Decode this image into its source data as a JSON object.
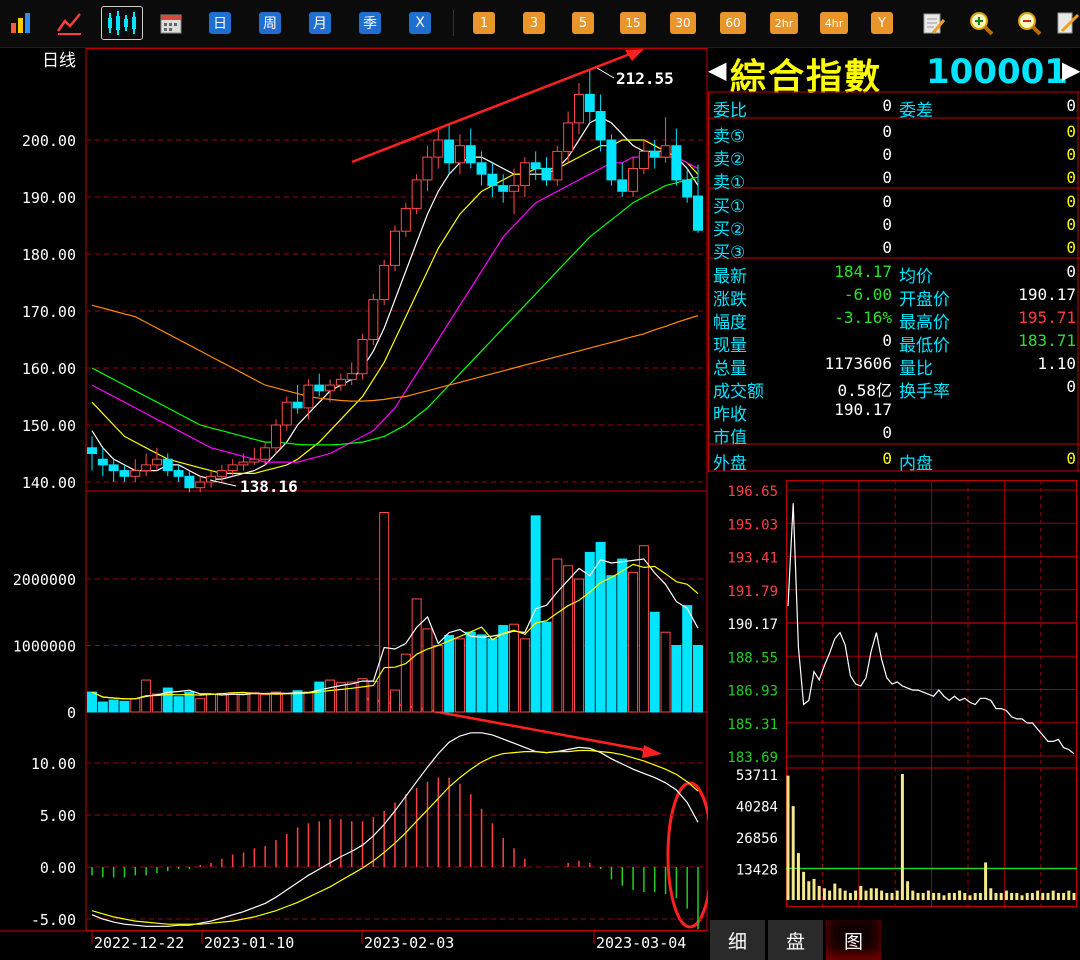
{
  "toolbar": {
    "period_buttons": [
      "日",
      "周",
      "月",
      "季",
      "X"
    ],
    "minute_buttons": [
      "1",
      "3",
      "5",
      "15",
      "30",
      "60",
      "2hr",
      "4hr",
      "Y"
    ]
  },
  "kline": {
    "period_label": "日线",
    "price_ticks": [
      "200.00",
      "190.00",
      "180.00",
      "170.00",
      "160.00",
      "150.00",
      "140.00"
    ],
    "high_label": "212.55",
    "low_label": "138.16",
    "volume_ticks": [
      "2000000",
      "1000000",
      "0"
    ],
    "macd_ticks": [
      "10.00",
      "5.00",
      "0.00",
      "-5.00"
    ],
    "dates": [
      "2022-12-22",
      "2023-01-10",
      "2023-02-03",
      "2023-03-04"
    ]
  },
  "chart_data": {
    "type": "candlestick",
    "price_axis": [
      140,
      200
    ],
    "candles": [
      {
        "o": 146,
        "c": 145,
        "h": 148,
        "l": 142
      },
      {
        "o": 144,
        "c": 143,
        "h": 146,
        "l": 141
      },
      {
        "o": 143,
        "c": 142,
        "h": 144,
        "l": 140
      },
      {
        "o": 142,
        "c": 141,
        "h": 143,
        "l": 140
      },
      {
        "o": 141,
        "c": 142,
        "h": 144,
        "l": 140
      },
      {
        "o": 142,
        "c": 143,
        "h": 145,
        "l": 141
      },
      {
        "o": 143,
        "c": 144,
        "h": 146,
        "l": 142
      },
      {
        "o": 144,
        "c": 142,
        "h": 145,
        "l": 141
      },
      {
        "o": 142,
        "c": 141,
        "h": 143,
        "l": 140
      },
      {
        "o": 141,
        "c": 139,
        "h": 142,
        "l": 138.2
      },
      {
        "o": 139,
        "c": 140,
        "h": 141,
        "l": 138.2
      },
      {
        "o": 140,
        "c": 141,
        "h": 142,
        "l": 139
      },
      {
        "o": 141,
        "c": 142,
        "h": 143,
        "l": 140
      },
      {
        "o": 142,
        "c": 143,
        "h": 144,
        "l": 141
      },
      {
        "o": 143,
        "c": 143.5,
        "h": 145,
        "l": 142
      },
      {
        "o": 143.5,
        "c": 144,
        "h": 146,
        "l": 143
      },
      {
        "o": 144,
        "c": 146,
        "h": 147,
        "l": 143
      },
      {
        "o": 146,
        "c": 150,
        "h": 151,
        "l": 145
      },
      {
        "o": 150,
        "c": 154,
        "h": 155,
        "l": 149
      },
      {
        "o": 154,
        "c": 153,
        "h": 157,
        "l": 152
      },
      {
        "o": 153,
        "c": 157,
        "h": 158,
        "l": 151
      },
      {
        "o": 157,
        "c": 156,
        "h": 159,
        "l": 155
      },
      {
        "o": 156,
        "c": 157,
        "h": 158,
        "l": 154
      },
      {
        "o": 157,
        "c": 158,
        "h": 159,
        "l": 156
      },
      {
        "o": 158,
        "c": 159,
        "h": 161,
        "l": 157
      },
      {
        "o": 159,
        "c": 165,
        "h": 166,
        "l": 158
      },
      {
        "o": 165,
        "c": 172,
        "h": 173,
        "l": 164
      },
      {
        "o": 172,
        "c": 178,
        "h": 179,
        "l": 171
      },
      {
        "o": 178,
        "c": 184,
        "h": 185,
        "l": 177
      },
      {
        "o": 184,
        "c": 188,
        "h": 189,
        "l": 183
      },
      {
        "o": 188,
        "c": 193,
        "h": 194,
        "l": 187
      },
      {
        "o": 193,
        "c": 197,
        "h": 199,
        "l": 191
      },
      {
        "o": 197,
        "c": 200,
        "h": 202,
        "l": 195
      },
      {
        "o": 200,
        "c": 196,
        "h": 203,
        "l": 194
      },
      {
        "o": 196,
        "c": 199,
        "h": 201,
        "l": 194
      },
      {
        "o": 199,
        "c": 196,
        "h": 202,
        "l": 195
      },
      {
        "o": 196,
        "c": 194,
        "h": 198,
        "l": 192
      },
      {
        "o": 194,
        "c": 192,
        "h": 196,
        "l": 190
      },
      {
        "o": 192,
        "c": 191,
        "h": 194,
        "l": 189
      },
      {
        "o": 191,
        "c": 192,
        "h": 195,
        "l": 187
      },
      {
        "o": 192,
        "c": 196,
        "h": 197,
        "l": 190
      },
      {
        "o": 196,
        "c": 195,
        "h": 198,
        "l": 193
      },
      {
        "o": 195,
        "c": 193,
        "h": 197,
        "l": 192
      },
      {
        "o": 193,
        "c": 198,
        "h": 199,
        "l": 192
      },
      {
        "o": 198,
        "c": 203,
        "h": 205,
        "l": 196
      },
      {
        "o": 203,
        "c": 208,
        "h": 210,
        "l": 201
      },
      {
        "o": 208,
        "c": 205,
        "h": 212.55,
        "l": 203
      },
      {
        "o": 205,
        "c": 200,
        "h": 208,
        "l": 198
      },
      {
        "o": 200,
        "c": 193,
        "h": 201,
        "l": 192
      },
      {
        "o": 193,
        "c": 191,
        "h": 196,
        "l": 190
      },
      {
        "o": 191,
        "c": 195,
        "h": 197,
        "l": 190
      },
      {
        "o": 195,
        "c": 198,
        "h": 200,
        "l": 194
      },
      {
        "o": 198,
        "c": 197,
        "h": 200,
        "l": 195
      },
      {
        "o": 197,
        "c": 199,
        "h": 204,
        "l": 196
      },
      {
        "o": 199,
        "c": 193,
        "h": 202,
        "l": 192
      },
      {
        "o": 193,
        "c": 190,
        "h": 195,
        "l": 189
      },
      {
        "o": 190.17,
        "c": 184.17,
        "h": 195.71,
        "l": 183.71
      }
    ],
    "ma_lines": [
      {
        "name": "MA5",
        "color": "#ffffff",
        "values": [
          149,
          146,
          144,
          143,
          142,
          142,
          142,
          143,
          143,
          142,
          141,
          140.5,
          140.5,
          141,
          141.5,
          142,
          143,
          145,
          147,
          150,
          152,
          154,
          156,
          157,
          158,
          160,
          163,
          167,
          172,
          177,
          182,
          187,
          191,
          194,
          196,
          197,
          197,
          196,
          195,
          194,
          194,
          194,
          194,
          195,
          197,
          200,
          203,
          204,
          203,
          201,
          199,
          198,
          198,
          198,
          197,
          195,
          192
        ]
      },
      {
        "name": "MA10",
        "color": "#ffff00",
        "values": [
          154,
          152,
          150,
          148,
          147,
          146,
          145,
          144,
          143.5,
          143,
          142.5,
          142,
          141.5,
          141.5,
          141.5,
          141.5,
          142,
          142.5,
          143,
          144,
          145.5,
          147,
          149,
          151,
          153,
          155,
          158,
          161,
          165,
          169,
          173,
          177,
          181,
          184,
          187,
          189,
          191,
          192,
          193,
          194,
          194,
          195,
          195,
          195,
          196,
          197,
          198,
          199,
          199,
          200,
          200,
          200,
          199,
          198,
          197,
          196,
          194
        ]
      },
      {
        "name": "MA20",
        "color": "#ff00ff",
        "values": [
          157,
          156,
          155,
          154,
          153,
          152,
          151,
          150,
          149,
          148,
          147,
          146,
          145.5,
          145,
          144.5,
          144,
          143.5,
          143.5,
          143.5,
          143.5,
          144,
          144.5,
          145,
          146,
          147,
          148,
          149,
          151,
          153,
          156,
          159,
          162,
          165,
          168,
          171,
          174,
          177,
          180,
          183,
          185,
          187,
          189,
          190,
          191,
          192,
          193,
          194,
          195,
          196,
          196,
          197,
          197,
          197,
          197,
          197,
          196,
          195
        ]
      },
      {
        "name": "MA30",
        "color": "#00ff00",
        "values": [
          160,
          159,
          158,
          157,
          156,
          155,
          154,
          153,
          152,
          151,
          150,
          149.5,
          149,
          148.5,
          148,
          147.5,
          147,
          147,
          146.8,
          146.6,
          146.5,
          146.5,
          146.5,
          146.6,
          146.8,
          147,
          147.5,
          148,
          149,
          150,
          151.5,
          153,
          155,
          157,
          159,
          161,
          163,
          165,
          167,
          169,
          171,
          173,
          175,
          177,
          179,
          181,
          183,
          184.5,
          186,
          187.5,
          189,
          190,
          191,
          192,
          192.5,
          193,
          193.5
        ]
      },
      {
        "name": "MA60",
        "color": "#ff8c00",
        "values": [
          171,
          170.5,
          170,
          169.5,
          169,
          168,
          167,
          166,
          165,
          164,
          163,
          162,
          161,
          160,
          159,
          158,
          157,
          156.5,
          156,
          155.5,
          155,
          154.7,
          154.5,
          154.3,
          154.2,
          154.2,
          154.3,
          154.5,
          154.8,
          155,
          155.5,
          156,
          156.5,
          157,
          157.5,
          158,
          158.5,
          159,
          159.5,
          160,
          160.5,
          161,
          161.5,
          162,
          162.5,
          163,
          163.5,
          164,
          164.5,
          165,
          165.5,
          166,
          166.7,
          167.3,
          168,
          168.6,
          169.2
        ]
      }
    ],
    "volume": [
      300000,
      150000,
      180000,
      160000,
      200000,
      480000,
      270000,
      360000,
      230000,
      300000,
      200000,
      270000,
      280000,
      290000,
      270000,
      290000,
      260000,
      300000,
      280000,
      320000,
      300000,
      450000,
      480000,
      440000,
      450000,
      500000,
      460000,
      3000000,
      330000,
      870000,
      1700000,
      1250000,
      1000000,
      1150000,
      1100000,
      1200000,
      1160000,
      1100000,
      1300000,
      1320000,
      1100000,
      2950000,
      1350000,
      2300000,
      2200000,
      2000000,
      2400000,
      2550000,
      2050000,
      2300000,
      2100000,
      2500000,
      1500000,
      1200000,
      1000000,
      1600000,
      1000000
    ],
    "macd_dif": [
      -4.6,
      -5.0,
      -5.3,
      -5.5,
      -5.6,
      -5.7,
      -5.7,
      -5.7,
      -5.6,
      -5.6,
      -5.4,
      -5.2,
      -4.9,
      -4.6,
      -4.3,
      -3.9,
      -3.5,
      -2.9,
      -2.2,
      -1.5,
      -0.8,
      -0.2,
      0.4,
      1.0,
      1.5,
      2.1,
      3.0,
      4.1,
      5.4,
      6.8,
      8.2,
      9.6,
      10.9,
      12.0,
      12.6,
      12.9,
      12.9,
      12.7,
      12.3,
      11.9,
      11.5,
      11.1,
      11.0,
      11.1,
      11.3,
      11.5,
      11.4,
      11.0,
      10.4,
      9.9,
      9.4,
      9.0,
      8.6,
      8.1,
      7.4,
      6.2,
      4.3
    ],
    "macd_dea": [
      -4.2,
      -4.5,
      -4.8,
      -5.0,
      -5.2,
      -5.3,
      -5.4,
      -5.5,
      -5.5,
      -5.5,
      -5.5,
      -5.4,
      -5.3,
      -5.2,
      -5.0,
      -4.8,
      -4.5,
      -4.2,
      -3.8,
      -3.4,
      -2.9,
      -2.4,
      -1.9,
      -1.3,
      -0.7,
      -0.1,
      0.6,
      1.4,
      2.3,
      3.3,
      4.4,
      5.5,
      6.6,
      7.7,
      8.6,
      9.4,
      10.1,
      10.6,
      10.9,
      11.0,
      11.1,
      11.1,
      11.0,
      11.1,
      11.1,
      11.2,
      11.2,
      11.1,
      11.0,
      10.8,
      10.5,
      10.2,
      9.8,
      9.4,
      8.9,
      8.2,
      7.3
    ]
  },
  "quote": {
    "name": "綜合指數",
    "code": "100001",
    "rows": [
      {
        "l1": "委比",
        "v1": "0",
        "l2": "委差",
        "v2": "0",
        "c2": "v-white"
      },
      {
        "l1": "卖⑤",
        "v1": "0",
        "v2": "0",
        "c2": "v-yellow"
      },
      {
        "l1": "卖②",
        "v1": "0",
        "v2": "0",
        "c2": "v-yellow"
      },
      {
        "l1": "卖①",
        "v1": "0",
        "v2": "0",
        "c2": "v-yellow"
      },
      {
        "l1": "买①",
        "v1": "0",
        "v2": "0",
        "c2": "v-yellow"
      },
      {
        "l1": "买②",
        "v1": "0",
        "v2": "0",
        "c2": "v-yellow"
      },
      {
        "l1": "买③",
        "v1": "0",
        "v2": "0",
        "c2": "v-yellow"
      },
      {
        "l1": "最新",
        "v1": "184.17",
        "c1": "v-green",
        "l2": "均价",
        "v2": "0",
        "c2": "v-white"
      },
      {
        "l1": "涨跌",
        "v1": "-6.00",
        "c1": "v-green",
        "l2": "开盘价",
        "v2": "190.17",
        "c2": "v-white"
      },
      {
        "l1": "幅度",
        "v1": "-3.16%",
        "c1": "v-green",
        "l2": "最高价",
        "v2": "195.71",
        "c2": "v-red"
      },
      {
        "l1": "现量",
        "v1": "0",
        "l2": "最低价",
        "v2": "183.71",
        "c2": "v-green"
      },
      {
        "l1": "总量",
        "v1": "1173606",
        "l2": "量比",
        "v2": "1.10",
        "c2": "v-white"
      },
      {
        "l1": "成交额",
        "v1": "0.58亿",
        "l2": "换手率",
        "v2": "0",
        "c2": "v-white"
      },
      {
        "l1": "昨收",
        "v1": "190.17"
      },
      {
        "l1": "市值",
        "v1": "0"
      },
      {
        "l1": "外盘",
        "v1": "0",
        "c1": "v-yellow",
        "l2": "内盘",
        "v2": "0",
        "c2": "v-yellow"
      }
    ]
  },
  "intraday": {
    "price_ticks": [
      "196.65",
      "195.03",
      "193.41",
      "191.79",
      "190.17",
      "188.55",
      "186.93",
      "185.31",
      "183.69"
    ],
    "volume_ticks": [
      "53711",
      "40284",
      "26856",
      "13428"
    ],
    "prices": [
      191,
      196,
      189,
      186.2,
      186.4,
      187.8,
      187.4,
      188.1,
      188.7,
      189.4,
      189.7,
      189.1,
      187.6,
      187.2,
      187.1,
      187.5,
      188.8,
      189.7,
      188.4,
      187.5,
      187.2,
      187.3,
      187.1,
      187.0,
      186.9,
      186.9,
      186.8,
      186.7,
      186.6,
      186.9,
      186.6,
      186.4,
      186.6,
      186.4,
      186.5,
      186.3,
      186.2,
      186.5,
      186.5,
      186.4,
      186.0,
      186.0,
      185.9,
      185.6,
      185.5,
      185.5,
      185.3,
      185.3,
      185.0,
      184.7,
      184.4,
      184.4,
      184.5,
      184.1,
      184.0,
      183.8
    ],
    "volumes": [
      53000,
      40000,
      20000,
      12000,
      8000,
      9000,
      6000,
      5000,
      4000,
      7000,
      5000,
      4000,
      3000,
      4000,
      6000,
      4000,
      5000,
      5000,
      4000,
      3000,
      3000,
      4000,
      53711,
      8000,
      4000,
      3000,
      3000,
      4000,
      3000,
      3000,
      2000,
      3000,
      3000,
      4000,
      3000,
      2000,
      3000,
      3000,
      16000,
      5000,
      3000,
      3000,
      4000,
      3000,
      3000,
      2000,
      3000,
      3000,
      4000,
      3000,
      3000,
      4000,
      3000,
      3000,
      4000,
      3000
    ]
  },
  "tabs": [
    "细",
    "盘",
    "图"
  ]
}
